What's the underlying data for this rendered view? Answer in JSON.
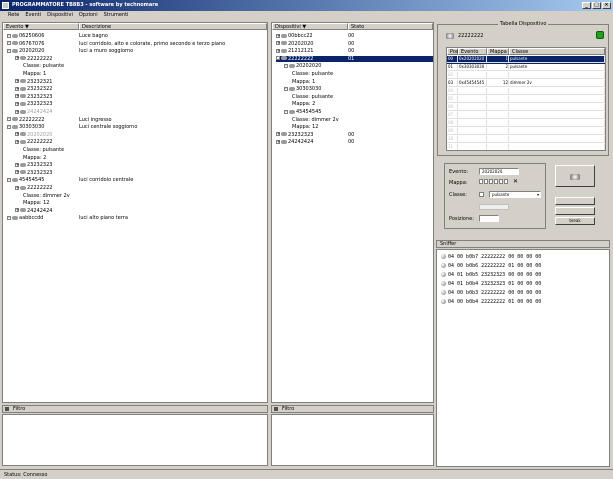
{
  "window": {
    "title": "PROGRAMMATORE  TB8B3 - software by technomare"
  },
  "menu": [
    "Rete",
    "Eventi",
    "Dispositivi",
    "Opzioni",
    "Strumenti"
  ],
  "left_panel": {
    "col_event": "Evento",
    "col_sort": "▼",
    "col_desc": "Descrizione",
    "rows": [
      {
        "text": "06250606",
        "desc": "Luce bagno",
        "indent": 0
      },
      {
        "text": "06767076",
        "desc": "luci corridoio, alto e colorate, primo secondo e terzo piano",
        "indent": 0
      },
      {
        "text": "20202020",
        "desc": "luci a muro soggiorno",
        "indent": 0
      },
      {
        "text": "22222222",
        "desc": "",
        "indent": 1
      },
      {
        "text": "Classe: pulsante",
        "desc": "",
        "indent": 2
      },
      {
        "text": "Mappa: 1",
        "desc": "",
        "indent": 2
      },
      {
        "text": "23232321",
        "desc": "",
        "indent": 1
      },
      {
        "text": "23232322",
        "desc": "",
        "indent": 1
      },
      {
        "text": "23232323",
        "desc": "",
        "indent": 1
      },
      {
        "text": "23232323",
        "desc": "",
        "indent": 1
      },
      {
        "text": "24242424",
        "desc": "",
        "indent": 1,
        "gray": true
      },
      {
        "text": "22222222",
        "desc": "Luci ingresso",
        "indent": 0
      },
      {
        "text": "30303030",
        "desc": "Luci centrale soggiorno",
        "indent": 0
      },
      {
        "text": "20202020",
        "desc": "",
        "indent": 1,
        "gray": true
      },
      {
        "text": "22222222",
        "desc": "",
        "indent": 1
      },
      {
        "text": "Classe: pulsante",
        "desc": "",
        "indent": 2
      },
      {
        "text": "Mappa: 2",
        "desc": "",
        "indent": 2
      },
      {
        "text": "23232323",
        "desc": "",
        "indent": 1
      },
      {
        "text": "23232323",
        "desc": "",
        "indent": 1
      },
      {
        "text": "45454545",
        "desc": "luci corridoio centrale",
        "indent": 0
      },
      {
        "text": "22222222",
        "desc": "",
        "indent": 1
      },
      {
        "text": "Classe: dimmer 2v",
        "desc": "",
        "indent": 2
      },
      {
        "text": "Mappa: 12",
        "desc": "",
        "indent": 2
      },
      {
        "text": "24242424",
        "desc": "",
        "indent": 1
      },
      {
        "text": "aabbccdd",
        "desc": "luci alto piano terra",
        "indent": 0
      }
    ],
    "filter_label": "Filtro"
  },
  "middle_panel": {
    "col_device": "Dispositivi",
    "col_sort": "▼",
    "col_state": "Stato",
    "rows": [
      {
        "text": "00bbcc22",
        "state": "00",
        "indent": 0
      },
      {
        "text": "20202020",
        "state": "00",
        "indent": 0
      },
      {
        "text": "21212121",
        "state": "00",
        "indent": 0
      },
      {
        "text": "22222222",
        "state": "01",
        "indent": 0,
        "selected": true
      },
      {
        "text": "20202020",
        "state": "",
        "indent": 1
      },
      {
        "text": "Classe: pulsante",
        "state": "",
        "indent": 2
      },
      {
        "text": "Mappa: 1",
        "state": "",
        "indent": 2
      },
      {
        "text": "30303030",
        "state": "",
        "indent": 1
      },
      {
        "text": "Classe: pulsante",
        "state": "",
        "indent": 2
      },
      {
        "text": "Mappa: 2",
        "state": "",
        "indent": 2
      },
      {
        "text": "45454545",
        "state": "",
        "indent": 1
      },
      {
        "text": "Classe: dimmer 2v",
        "state": "",
        "indent": 2
      },
      {
        "text": "Mappa: 12",
        "state": "",
        "indent": 2
      },
      {
        "text": "23232323",
        "state": "00",
        "indent": 0
      },
      {
        "text": "24242424",
        "state": "00",
        "indent": 0
      }
    ],
    "filter_label": "Filtro"
  },
  "device_table": {
    "title": "Tabella Dispositivo",
    "device_id": "22222222",
    "columns": [
      "Pos",
      "Evento",
      "Mappa",
      "Classe"
    ],
    "rows": [
      {
        "pos": "00",
        "evento": "0x20202020",
        "mappa": "1",
        "classe": "pulsante",
        "selected": true
      },
      {
        "pos": "01",
        "evento": "0x30303030",
        "mappa": "2",
        "classe": "pulsante"
      },
      {
        "pos": "02",
        "evento": "",
        "mappa": "",
        "classe": ""
      },
      {
        "pos": "03",
        "evento": "0x45454545",
        "mappa": "12",
        "classe": "dimmer 2v"
      },
      {
        "pos": "04",
        "evento": "",
        "mappa": "",
        "classe": ""
      },
      {
        "pos": "05",
        "evento": "",
        "mappa": "",
        "classe": ""
      },
      {
        "pos": "06",
        "evento": "",
        "mappa": "",
        "classe": ""
      },
      {
        "pos": "07",
        "evento": "",
        "mappa": "",
        "classe": ""
      },
      {
        "pos": "08",
        "evento": "",
        "mappa": "",
        "classe": ""
      },
      {
        "pos": "09",
        "evento": "",
        "mappa": "",
        "classe": ""
      },
      {
        "pos": "10",
        "evento": "",
        "mappa": "",
        "classe": ""
      },
      {
        "pos": "11",
        "evento": "",
        "mappa": "",
        "classe": ""
      }
    ]
  },
  "edit_form": {
    "evento_label": "Evento:",
    "evento_value": "20202020",
    "mappa_label": "Mappa:",
    "classe_label": "Classe:",
    "classe_value": "pulsante",
    "posizione_label": "Posizione:",
    "buttons": [
      "",
      "",
      "break"
    ]
  },
  "sniffer": {
    "title": "Sniffer",
    "rows": [
      "04 00 b0b7 22222222 00 00 00 00",
      "04 00 b0b6 22222222 01 00 00 00",
      "04 01 b0b5 23232323 00 00 00 00",
      "04 01 b0b4 23232323 01 00 00 00",
      "04 00 b0b3 22222222 00 00 00 00",
      "04 00 b0b4 22222222 01 00 00 00"
    ]
  },
  "status": {
    "text": "Status: Connesso"
  },
  "colors": {
    "title_start": "#0a246a",
    "title_end": "#a6caf0",
    "selection": "#0a246a",
    "ok_icon": "#22a022"
  }
}
